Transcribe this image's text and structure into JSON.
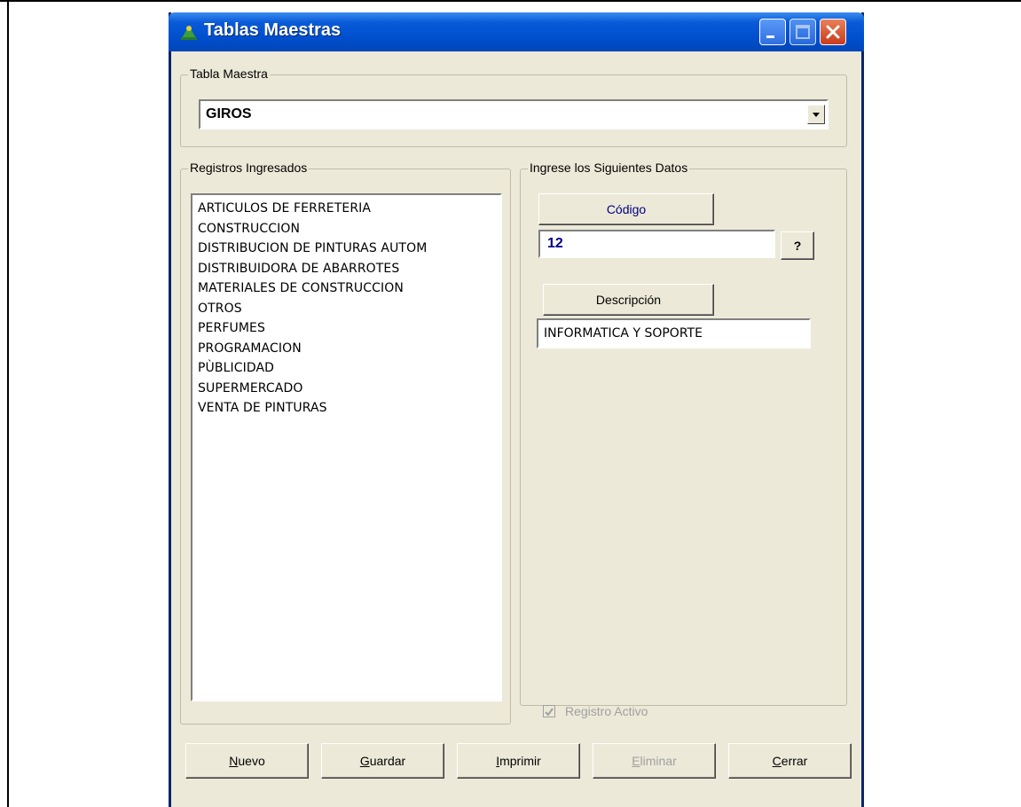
{
  "window": {
    "title": "Tablas Maestras"
  },
  "tabla_maestra": {
    "group_label": "Tabla Maestra",
    "selected": "GIROS"
  },
  "registros": {
    "group_label": "Registros Ingresados",
    "items": [
      "ARTICULOS DE FERRETERIA",
      "CONSTRUCCION",
      "DISTRIBUCION DE PINTURAS AUTOM",
      "DISTRIBUIDORA DE ABARROTES",
      "MATERIALES DE CONSTRUCCION",
      "OTROS",
      "PERFUMES",
      "PROGRAMACION",
      "PÙBLICIDAD",
      "SUPERMERCADO",
      "VENTA DE PINTURAS"
    ]
  },
  "datos": {
    "group_label": "Ingrese los Siguientes Datos",
    "codigo_label": "Código",
    "codigo_value": "12",
    "help_label": "?",
    "descripcion_label": "Descripción",
    "descripcion_value": "INFORMATICA Y SOPORTE",
    "activo_label": "Registro Activo",
    "activo_checked": true
  },
  "buttons": {
    "nuevo": {
      "hot": "N",
      "rest": "uevo"
    },
    "guardar": {
      "hot": "G",
      "rest": "uardar"
    },
    "imprimir": {
      "hot": "I",
      "rest": "mprimir"
    },
    "eliminar": {
      "hot": "E",
      "rest": "liminar"
    },
    "cerrar": {
      "hot": "C",
      "rest": "errar"
    }
  },
  "colors": {
    "title_bar": "#0050D0",
    "face": "#ECE9D8",
    "disabled_text": "#A0A0A0",
    "codigo_text": "#000080"
  }
}
